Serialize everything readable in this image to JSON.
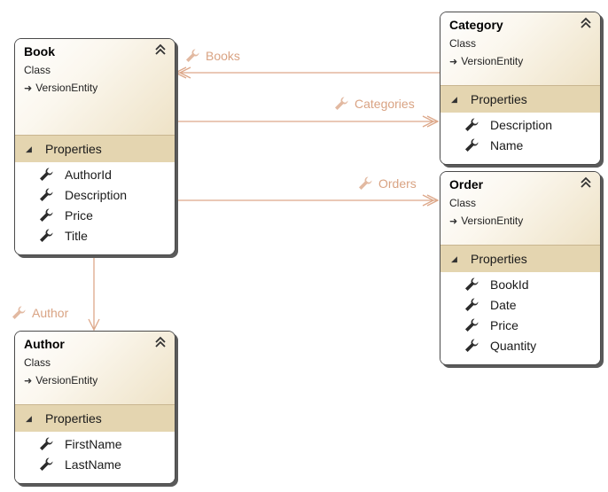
{
  "colors": {
    "connector": "#dda88a",
    "label": "#d9a383",
    "section_bg": "#e4d5b0",
    "border": "#4a4a4a"
  },
  "classes": {
    "book": {
      "name": "Book",
      "kind": "Class",
      "base": "VersionEntity",
      "section": "Properties",
      "properties": [
        "AuthorId",
        "Description",
        "Price",
        "Title"
      ]
    },
    "category": {
      "name": "Category",
      "kind": "Class",
      "base": "VersionEntity",
      "section": "Properties",
      "properties": [
        "Description",
        "Name"
      ]
    },
    "order": {
      "name": "Order",
      "kind": "Class",
      "base": "VersionEntity",
      "section": "Properties",
      "properties": [
        "BookId",
        "Date",
        "Price",
        "Quantity"
      ]
    },
    "author": {
      "name": "Author",
      "kind": "Class",
      "base": "VersionEntity",
      "section": "Properties",
      "properties": [
        "FirstName",
        "LastName"
      ]
    }
  },
  "associations": {
    "books": "Books",
    "categories": "Categories",
    "orders": "Orders",
    "author": "Author"
  },
  "icons": {
    "property": "wrench-icon",
    "collapse": "double-chevron-up-icon",
    "base": "inheritance-arrow-icon",
    "section": "triangle-expanded-icon"
  }
}
